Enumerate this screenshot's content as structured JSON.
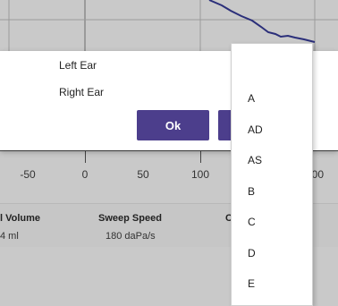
{
  "dialog": {
    "options": [
      "Left Ear",
      "Right Ear"
    ],
    "ok_label": "Ok"
  },
  "axis": {
    "ticks": [
      "-50",
      "0",
      "50",
      "100",
      "200"
    ]
  },
  "results": {
    "columns": [
      {
        "header": "l Volume",
        "value": "4 ml"
      },
      {
        "header": "Sweep Speed",
        "value": "180 daPa/s"
      },
      {
        "header": "C",
        "value": ""
      }
    ]
  },
  "dropdown": {
    "items": [
      "A",
      "AD",
      "AS",
      "B",
      "C",
      "D",
      "E"
    ]
  },
  "colors": {
    "accent": "#4c3e8c",
    "curve": "#2b2f7a",
    "background": "#c9c9c9"
  }
}
